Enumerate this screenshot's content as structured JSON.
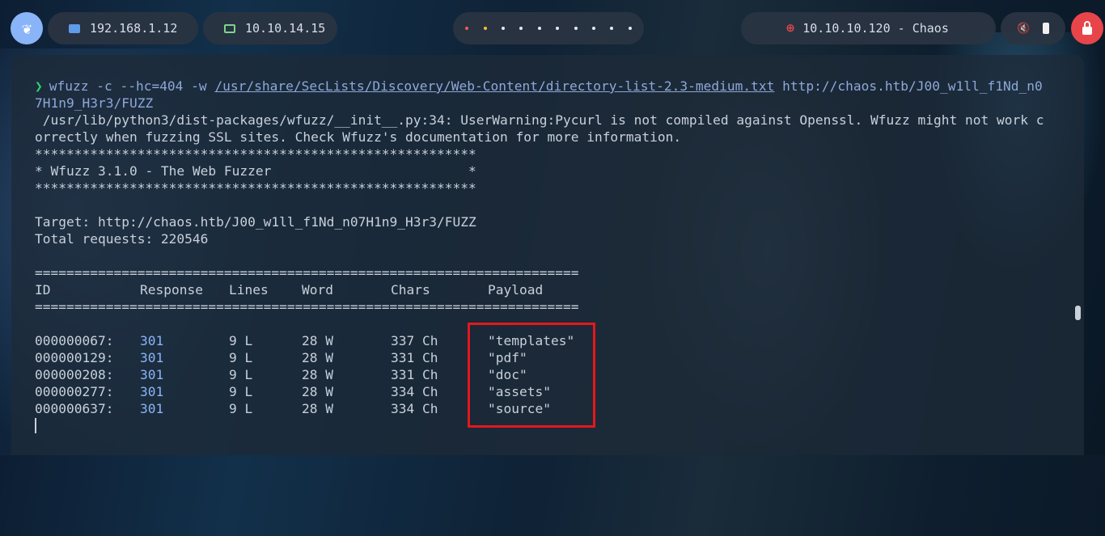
{
  "topbar": {
    "ip_local": "192.168.1.12",
    "ip_vpn": "10.10.14.15",
    "target": "10.10.10.120 - Chaos",
    "workspace_count": 10
  },
  "terminal": {
    "prompt_symbol": "❯",
    "command_prefix": "wfuzz -c --hc=404 -w ",
    "command_wordlist": "/usr/share/SecLists/Discovery/Web-Content/directory-list-2.3-medium.txt",
    "command_url_line1": " http://chaos.htb/J00_w1ll_f1Nd_n0",
    "command_url_line2": "7H1n9_H3r3/FUZZ",
    "warning_line1": " /usr/lib/python3/dist-packages/wfuzz/__init__.py:34: UserWarning:Pycurl is not compiled against Openssl. Wfuzz might not work c",
    "warning_line2": "orrectly when fuzzing SSL sites. Check Wfuzz's documentation for more information.",
    "banner_stars": "********************************************************",
    "banner_title": "* Wfuzz 3.1.0 - The Web Fuzzer                         *",
    "target_line": "Target: http://chaos.htb/J00_w1ll_f1Nd_n07H1n9_H3r3/FUZZ",
    "total_line": "Total requests: 220546",
    "separator": "=====================================================================",
    "headers": {
      "id": "ID",
      "response": "Response",
      "lines": "Lines",
      "word": "Word",
      "chars": "Chars",
      "payload": "Payload"
    },
    "rows": [
      {
        "id": "000000067:",
        "response": "301",
        "lines": "9 L",
        "word": "28 W",
        "chars": "337 Ch",
        "payload": "\"templates\""
      },
      {
        "id": "000000129:",
        "response": "301",
        "lines": "9 L",
        "word": "28 W",
        "chars": "331 Ch",
        "payload": "\"pdf\""
      },
      {
        "id": "000000208:",
        "response": "301",
        "lines": "9 L",
        "word": "28 W",
        "chars": "331 Ch",
        "payload": "\"doc\""
      },
      {
        "id": "000000277:",
        "response": "301",
        "lines": "9 L",
        "word": "28 W",
        "chars": "334 Ch",
        "payload": "\"assets\""
      },
      {
        "id": "000000637:",
        "response": "301",
        "lines": "9 L",
        "word": "28 W",
        "chars": "334 Ch",
        "payload": "\"source\""
      }
    ]
  },
  "colors": {
    "prompt": "#2bd46a",
    "link": "#8ea8d8",
    "response_code": "#8ab4f8",
    "highlight_box": "#e4171c",
    "lock_button": "#e8454a"
  }
}
